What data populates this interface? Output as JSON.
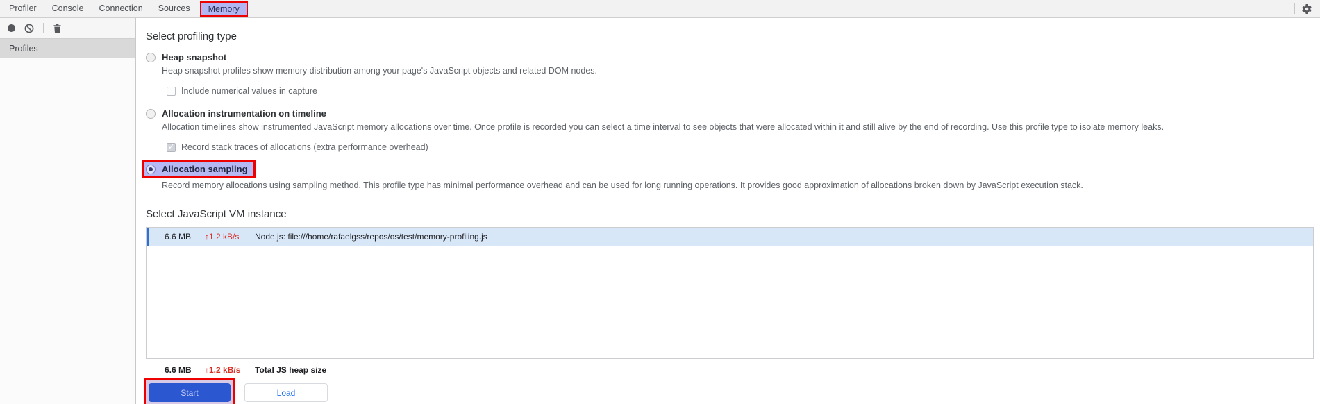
{
  "tabbar": {
    "tabs": [
      {
        "label": "Profiler",
        "active": false
      },
      {
        "label": "Console",
        "active": false
      },
      {
        "label": "Connection",
        "active": false
      },
      {
        "label": "Sources",
        "active": false
      },
      {
        "label": "Memory",
        "active": true,
        "annotated": true
      }
    ]
  },
  "toolbar": {
    "icons": [
      "record-icon",
      "block-icon",
      "trash-icon"
    ]
  },
  "sidebar": {
    "header": "Profiles"
  },
  "profiling": {
    "heading": "Select profiling type",
    "options": [
      {
        "label": "Heap snapshot",
        "selected": false,
        "description": "Heap snapshot profiles show memory distribution among your page's JavaScript objects and related DOM nodes.",
        "checkbox": {
          "label": "Include numerical values in capture",
          "checked": false
        }
      },
      {
        "label": "Allocation instrumentation on timeline",
        "selected": false,
        "description": "Allocation timelines show instrumented JavaScript memory allocations over time. Once profile is recorded you can select a time interval to see objects that were allocated within it and still alive by the end of recording. Use this profile type to isolate memory leaks.",
        "checkbox": {
          "label": "Record stack traces of allocations (extra performance overhead)",
          "checked": true
        }
      },
      {
        "label": "Allocation sampling",
        "selected": true,
        "annotated": true,
        "description": "Record memory allocations using sampling method. This profile type has minimal performance overhead and can be used for long running operations. It provides good approximation of allocations broken down by JavaScript execution stack."
      }
    ]
  },
  "vm": {
    "heading": "Select JavaScript VM instance",
    "rows": [
      {
        "size": "6.6 MB",
        "rate": "↑1.2 kB/s",
        "name": "Node.js: file:///home/rafaelgss/repos/os/test/memory-profiling.js",
        "selected": true
      }
    ],
    "total": {
      "size": "6.6 MB",
      "rate": "↑1.2 kB/s",
      "label": "Total JS heap size"
    }
  },
  "actions": {
    "start_label": "Start",
    "load_label": "Load",
    "start_annotated": true
  },
  "colors": {
    "accent_blue": "#1a73e8",
    "annotation_red": "#ee0000",
    "annotation_lavender": "#b2b6f2",
    "selected_row_bg": "#d8e7f8",
    "rate_red": "#d93025",
    "sidebar_selected_bg": "#d9d9d9"
  }
}
